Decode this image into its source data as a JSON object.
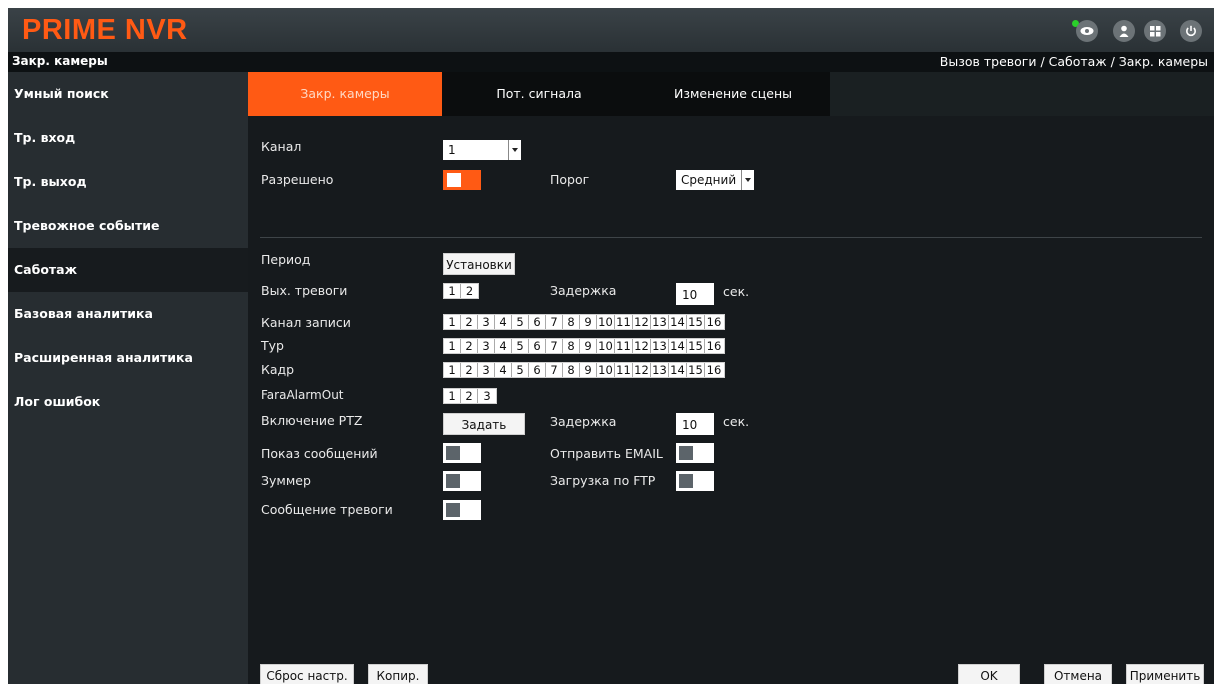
{
  "app": {
    "logo": "PRIME NVR"
  },
  "subbar": {
    "title": "Закр. камеры",
    "breadcrumb": "Вызов тревоги / Саботаж / Закр. камеры"
  },
  "topbar_icons": [
    "eye-icon",
    "user-icon",
    "grid-icon",
    "power-icon"
  ],
  "sidebar": {
    "items": [
      {
        "label": "Умный поиск"
      },
      {
        "label": "Тр. вход"
      },
      {
        "label": "Тр. выход"
      },
      {
        "label": "Тревожное событие"
      },
      {
        "label": "Саботаж",
        "active": true
      },
      {
        "label": "Базовая аналитика"
      },
      {
        "label": "Расширенная аналитика"
      },
      {
        "label": "Лог ошибок"
      }
    ]
  },
  "tabs": [
    {
      "label": "Закр. камеры",
      "active": true
    },
    {
      "label": "Пот. сигнала"
    },
    {
      "label": "Изменение сцены"
    }
  ],
  "form": {
    "channel_label": "Канал",
    "channel_value": "1",
    "enabled_label": "Разрешено",
    "enabled_on": true,
    "threshold_label": "Порог",
    "threshold_value": "Средний",
    "period_label": "Период",
    "period_button": "Установки",
    "alarm_out_label": "Вых. тревоги",
    "alarm_out_cells": [
      "1",
      "2"
    ],
    "delay_label": "Задержка",
    "delay_value": "10",
    "delay_unit": "сек.",
    "record_channel_label": "Канал записи",
    "record_channel_cells": [
      "1",
      "2",
      "3",
      "4",
      "5",
      "6",
      "7",
      "8",
      "9",
      "10",
      "11",
      "12",
      "13",
      "14",
      "15",
      "16"
    ],
    "tour_label": "Тур",
    "tour_cells": [
      "1",
      "2",
      "3",
      "4",
      "5",
      "6",
      "7",
      "8",
      "9",
      "10",
      "11",
      "12",
      "13",
      "14",
      "15",
      "16"
    ],
    "frame_label": "Кадр",
    "frame_cells": [
      "1",
      "2",
      "3",
      "4",
      "5",
      "6",
      "7",
      "8",
      "9",
      "10",
      "11",
      "12",
      "13",
      "14",
      "15",
      "16"
    ],
    "fara_label": "FaraAlarmOut",
    "fara_cells": [
      "1",
      "2",
      "3"
    ],
    "ptz_label": "Включение PTZ",
    "ptz_button": "Задать",
    "ptz_delay_label": "Задержка",
    "ptz_delay_value": "10",
    "ptz_delay_unit": "сек.",
    "show_msg_label": "Показ сообщений",
    "send_email_label": "Отправить EMAIL",
    "buzzer_label": "Зуммер",
    "ftp_label": "Загрузка по FTP",
    "alarm_msg_label": "Сообщение тревоги"
  },
  "bottom": {
    "reset": "Сброс настр.",
    "copy": "Копир.",
    "ok": "OK",
    "cancel": "Отмена",
    "apply": "Применить"
  },
  "colors": {
    "accent": "#ff5a14",
    "status_dot": "#2ad02a"
  }
}
